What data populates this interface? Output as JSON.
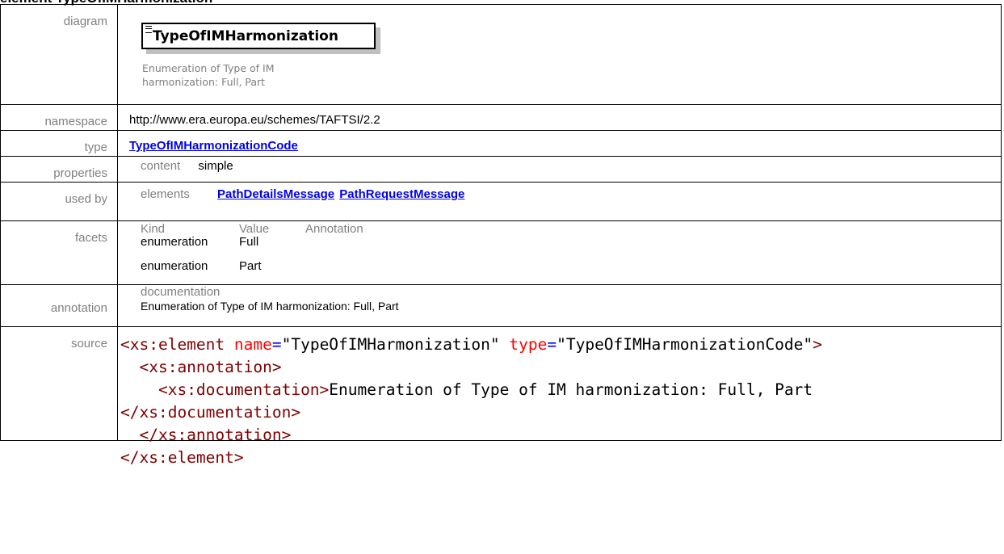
{
  "heading": "element TypeOfIMHarmonization",
  "labels": {
    "diagram": "diagram",
    "namespace": "namespace",
    "type": "type",
    "properties": "properties",
    "used_by": "used by",
    "facets": "facets",
    "annotation": "annotation",
    "source": "source"
  },
  "diagram": {
    "element_name": "TypeOfIMHarmonization",
    "note_line1": "Enumeration of Type of IM",
    "note_line2": "harmonization: Full, Part"
  },
  "namespace": "http://www.era.europa.eu/schemes/TAFTSI/2.2",
  "type_link": "TypeOfIMHarmonizationCode",
  "properties": {
    "key": "content",
    "value": "simple"
  },
  "used_by": {
    "key": "elements",
    "links": [
      "PathDetailsMessage",
      "PathRequestMessage"
    ]
  },
  "facets": {
    "headers": [
      "Kind",
      "Value",
      "Annotation"
    ],
    "rows": [
      {
        "kind": "enumeration",
        "value": "Full"
      },
      {
        "kind": "enumeration",
        "value": "Part"
      }
    ]
  },
  "annotation": {
    "key": "documentation",
    "value": "Enumeration of Type of IM harmonization: Full, Part"
  },
  "source": {
    "el_open": "<xs:element",
    "attr_name": "name",
    "eq": "=",
    "name_val": "\"TypeOfIMHarmonization\"",
    "attr_type": "type",
    "type_val": "\"TypeOfIMHarmonizationCode\"",
    "gt": ">",
    "ann_open": "<xs:annotation>",
    "doc_open": "<xs:documentation>",
    "doc_text": "Enumeration of Type of IM harmonization: Full, Part",
    "doc_close": "</xs:documentation>",
    "ann_close": "</xs:annotation>",
    "el_close": "</xs:element>"
  },
  "colors": {
    "tag": "#800000",
    "attribute": "#ff0000",
    "attribute_value": "#0000ff",
    "link": "#0000ee",
    "label": "#808080"
  }
}
